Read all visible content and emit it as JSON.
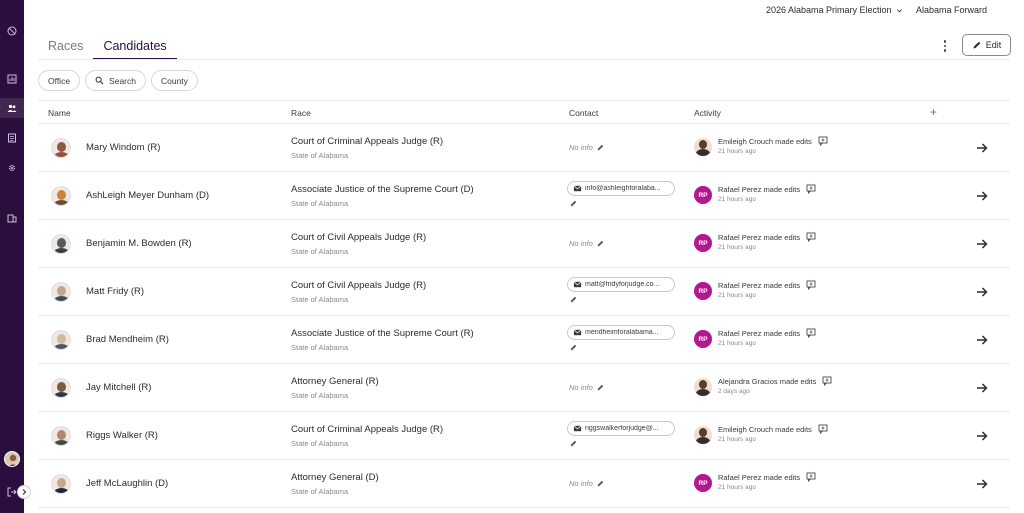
{
  "header": {
    "election": "2026 Alabama Primary Election",
    "organization": "Alabama Forward"
  },
  "tabs": [
    {
      "label": "Races",
      "active": false
    },
    {
      "label": "Candidates",
      "active": true
    }
  ],
  "toolbar": {
    "edit_label": "Edit"
  },
  "filters": {
    "office": "Office",
    "search": "Search",
    "county": "County"
  },
  "columns": {
    "name": "Name",
    "race": "Race",
    "contact": "Contact",
    "activity": "Activity"
  },
  "rows": [
    {
      "name": "Mary Windom (R)",
      "race": "Court of Criminal Appeals Judge (R)",
      "race_sub": "State of Alabama",
      "contact_email": null,
      "no_info": "No info",
      "activity": "Emileigh Crouch made edits",
      "activity_time": "21 hours ago",
      "actor_initials": null
    },
    {
      "name": "AshLeigh Meyer Dunham (D)",
      "race": "Associate Justice of the Supreme Court (D)",
      "race_sub": "State of Alabama",
      "contact_email": "info@ashleighforalaba...",
      "no_info": null,
      "activity": "Rafael Perez made edits",
      "activity_time": "21 hours ago",
      "actor_initials": "RP"
    },
    {
      "name": "Benjamin M. Bowden (R)",
      "race": "Court of Civil Appeals Judge (R)",
      "race_sub": "State of Alabama",
      "contact_email": null,
      "no_info": "No info",
      "activity": "Rafael Perez made edits",
      "activity_time": "21 hours ago",
      "actor_initials": "RP"
    },
    {
      "name": "Matt Fridy (R)",
      "race": "Court of Civil Appeals Judge (R)",
      "race_sub": "State of Alabama",
      "contact_email": "matt@fridyforjudge.co...",
      "no_info": null,
      "activity": "Rafael Perez made edits",
      "activity_time": "21 hours ago",
      "actor_initials": "RP"
    },
    {
      "name": "Brad Mendheim (R)",
      "race": "Associate Justice of the Supreme Court (R)",
      "race_sub": "State of Alabama",
      "contact_email": "mendheimforalabama...",
      "no_info": null,
      "activity": "Rafael Perez made edits",
      "activity_time": "21 hours ago",
      "actor_initials": "RP"
    },
    {
      "name": "Jay Mitchell (R)",
      "race": "Attorney General (R)",
      "race_sub": "State of Alabama",
      "contact_email": null,
      "no_info": "No info",
      "activity": "Alejandra Gracios made edits",
      "activity_time": "2 days ago",
      "actor_initials": null
    },
    {
      "name": "Riggs Walker (R)",
      "race": "Court of Criminal Appeals Judge (R)",
      "race_sub": "State of Alabama",
      "contact_email": "riggswalkerforjudge@...",
      "no_info": null,
      "activity": "Emileigh Crouch made edits",
      "activity_time": "21 hours ago",
      "actor_initials": null
    },
    {
      "name": "Jeff McLaughlin (D)",
      "race": "Attorney General (D)",
      "race_sub": "State of Alabama",
      "contact_email": null,
      "no_info": "No info",
      "activity": "Rafael Perez made edits",
      "activity_time": "21 hours ago",
      "actor_initials": "RP"
    }
  ],
  "colors": {
    "sidebar": "#2a0f3e",
    "accent": "#2a0f3e",
    "actor_badge": "#b3198f"
  },
  "icons": [
    "logo-icon",
    "chart-icon",
    "people-icon",
    "list-icon",
    "gear-icon",
    "building-icon",
    "logout-icon",
    "chevron-right-icon",
    "search-icon",
    "pencil-icon",
    "mail-icon",
    "comment-icon",
    "arrow-right-icon",
    "plus-icon"
  ]
}
